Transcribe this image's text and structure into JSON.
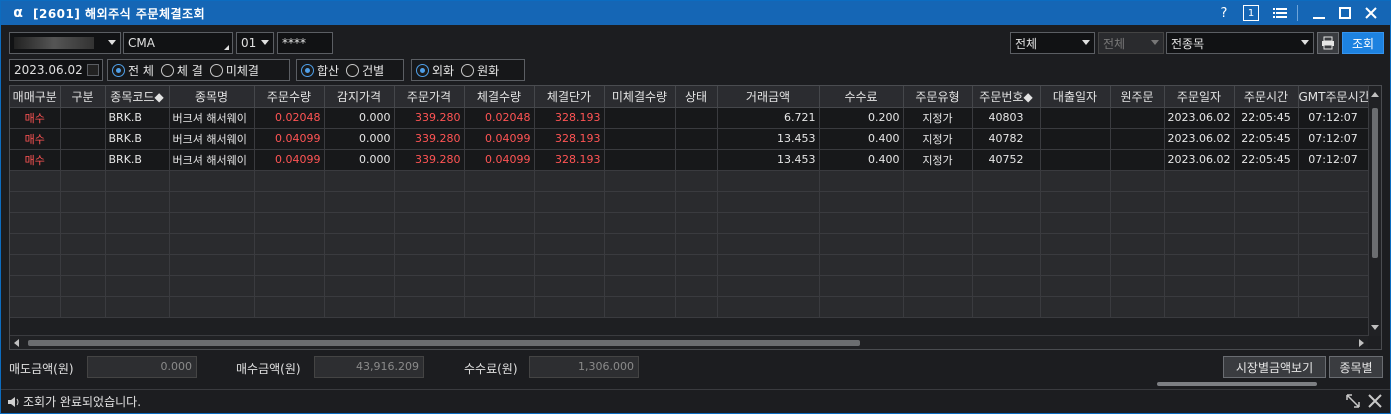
{
  "window": {
    "title": "[2601] 해외주식 주문체결조회",
    "logo": "α"
  },
  "titlebar": {
    "help": "?",
    "page_num": "1"
  },
  "filters": {
    "account": "",
    "account_type": "CMA",
    "sub_account": "01",
    "password": "****",
    "market": "전체",
    "market2": "전체",
    "stock_scope": "전종목",
    "query_btn": "조회",
    "date": "2023.06.02",
    "exec_opts": [
      "전 체",
      "체 결",
      "미체결"
    ],
    "exec_selected": 0,
    "sum_opts": [
      "합산",
      "건별"
    ],
    "sum_selected": 0,
    "cur_opts": [
      "외화",
      "원화"
    ],
    "cur_selected": 0
  },
  "table": {
    "columns": [
      "매매구분",
      "구분",
      "종목코드◆",
      "종목명",
      "주문수량",
      "감지가격",
      "주문가격",
      "체결수량",
      "체결단가",
      "미체결수량",
      "상태",
      "거래금액",
      "수수료",
      "주문유형",
      "주문번호◆",
      "대출일자",
      "원주문",
      "주문일자",
      "주문시간",
      "GMT주문시간"
    ],
    "rows": [
      [
        "매수",
        "",
        "BRK.B",
        "버크셔 해서웨이",
        "0.02048",
        "0.000",
        "339.280",
        "0.02048",
        "328.193",
        "",
        "",
        "6.721",
        "0.200",
        "지정가",
        "40803",
        "",
        "",
        "2023.06.02",
        "22:05:45",
        "07:12:07"
      ],
      [
        "매수",
        "",
        "BRK.B",
        "버크셔 해서웨이",
        "0.04099",
        "0.000",
        "339.280",
        "0.04099",
        "328.193",
        "",
        "",
        "13.453",
        "0.400",
        "지정가",
        "40782",
        "",
        "",
        "2023.06.02",
        "22:05:45",
        "07:12:07"
      ],
      [
        "매수",
        "",
        "BRK.B",
        "버크셔 해서웨이",
        "0.04099",
        "0.000",
        "339.280",
        "0.04099",
        "328.193",
        "",
        "",
        "13.453",
        "0.400",
        "지정가",
        "40752",
        "",
        "",
        "2023.06.02",
        "22:05:45",
        "07:12:07"
      ]
    ]
  },
  "summary": {
    "sell_label": "매도금액(원)",
    "sell_value": "0.000",
    "buy_label": "매수금액(원)",
    "buy_value": "43,916.209",
    "fee_label": "수수료(원)",
    "fee_value": "1,306.000",
    "market_btn": "시장별금액보기",
    "stock_btn": "종목별"
  },
  "status": {
    "message": "조회가 완료되었습니다."
  },
  "colors": {
    "title_bar": "#1566b5",
    "buy_red": "#ff5454",
    "query_blue": "#1d82e0"
  }
}
